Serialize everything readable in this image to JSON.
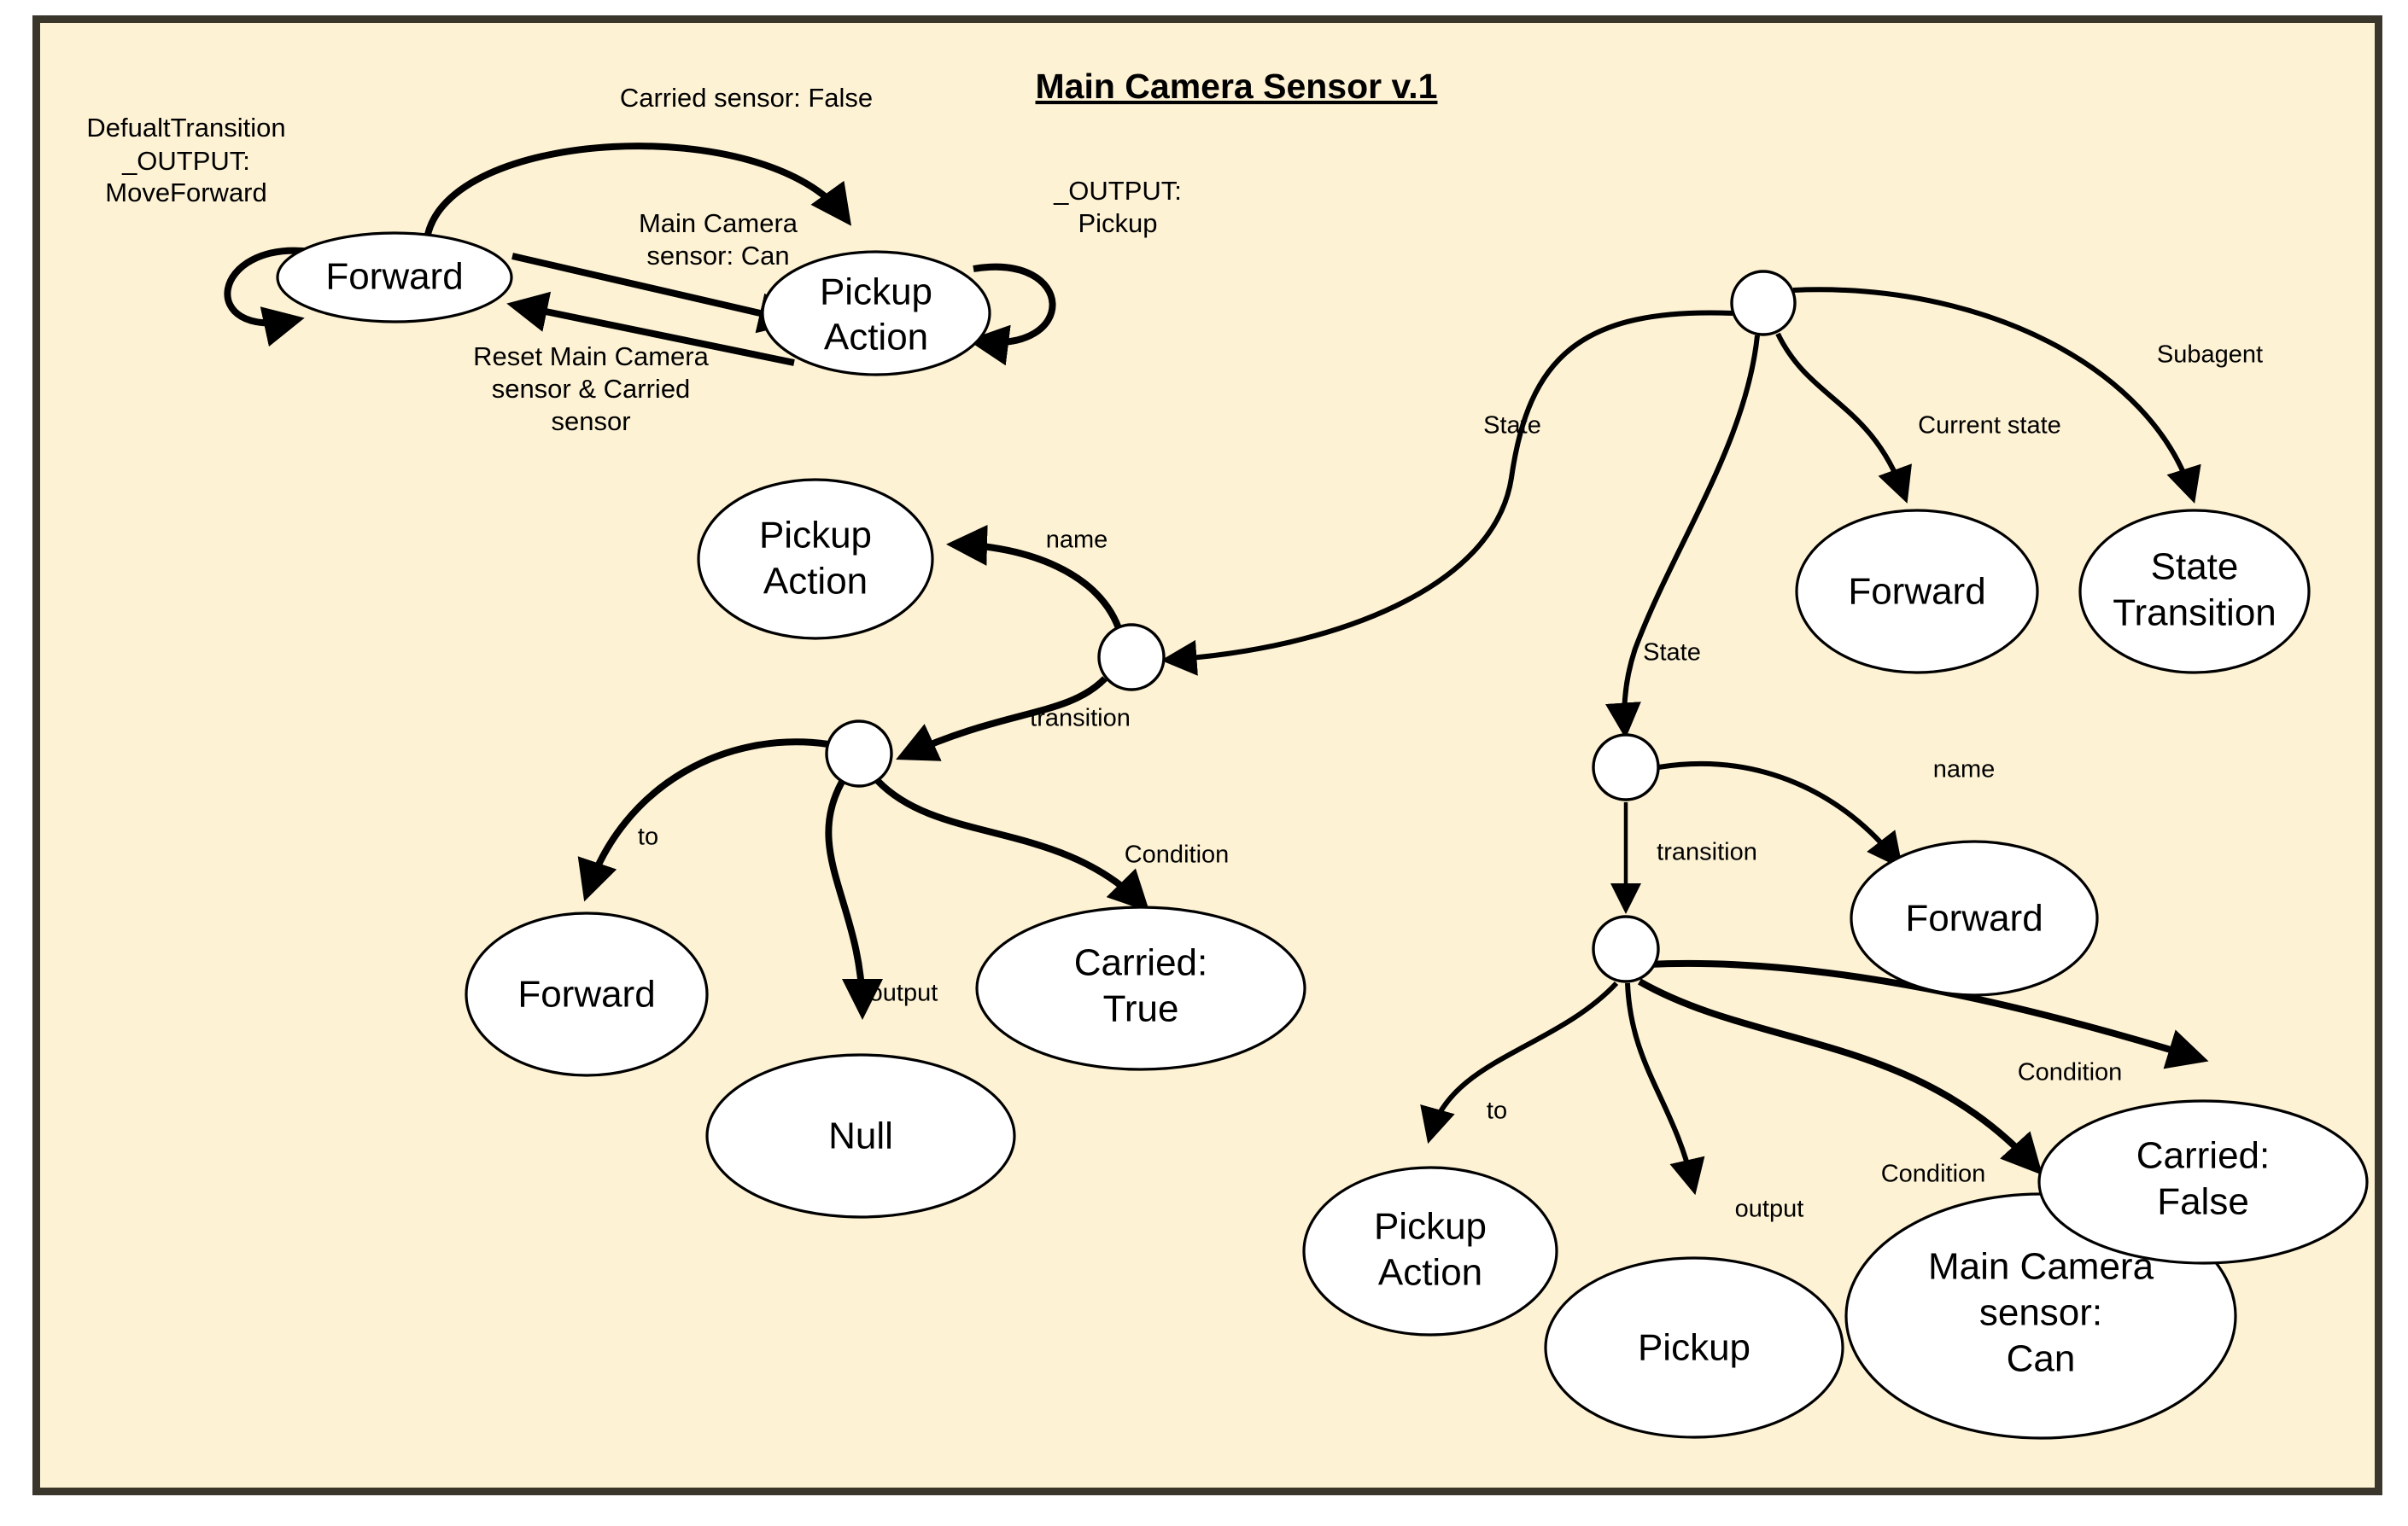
{
  "title": "Main Camera Sensor v.1",
  "colors": {
    "canvas_background": "#fdf2d4",
    "frame_border": "#3b362c",
    "node_fill": "#ffffff",
    "stroke": "#000000",
    "page_background": "#ffffff"
  },
  "state_machine": {
    "states": [
      {
        "id": "sm-forward",
        "label": "Forward"
      },
      {
        "id": "sm-pickup-action",
        "label_line1": "Pickup",
        "label_line2": "Action"
      }
    ],
    "labels": {
      "self_loop_forward_l1": "DefualtTransition",
      "self_loop_forward_l2": "_OUTPUT:",
      "self_loop_forward_l3": "MoveForward",
      "top_arc": "Carried sensor: False",
      "forward_to_pickup_l1": "Main Camera",
      "forward_to_pickup_l2": "sensor: Can",
      "pickup_to_forward_l1": "Reset Main Camera",
      "pickup_to_forward_l2": "sensor & Carried",
      "pickup_to_forward_l3": "sensor",
      "self_loop_pickup_l1": "_OUTPUT:",
      "self_loop_pickup_l2": "Pickup"
    }
  },
  "graph": {
    "junction_nodes": [
      {
        "id": "root",
        "name": "root-junction"
      },
      {
        "id": "left-transition-parent",
        "name": "left-state-junction"
      },
      {
        "id": "left-transition",
        "name": "left-transition-junction"
      },
      {
        "id": "right-state",
        "name": "right-state-junction"
      },
      {
        "id": "right-transition",
        "name": "right-transition-junction"
      }
    ],
    "leaf_nodes": [
      {
        "id": "leaf-pickup-action-name",
        "label_line1": "Pickup",
        "label_line2": "Action"
      },
      {
        "id": "leaf-forward-current-state",
        "label_line1": "Forward",
        "label_line2": ""
      },
      {
        "id": "leaf-state-transition",
        "label_line1": "State",
        "label_line2": "Transition"
      },
      {
        "id": "leaf-forward-to",
        "label_line1": "Forward",
        "label_line2": ""
      },
      {
        "id": "leaf-null-output",
        "label_line1": "Null",
        "label_line2": ""
      },
      {
        "id": "leaf-carried-true",
        "label_line1": "Carried:",
        "label_line2": "True"
      },
      {
        "id": "leaf-forward-name",
        "label_line1": "Forward",
        "label_line2": ""
      },
      {
        "id": "leaf-pickup-action-to",
        "label_line1": "Pickup",
        "label_line2": "Action"
      },
      {
        "id": "leaf-pickup-output",
        "label_line1": "Pickup",
        "label_line2": ""
      },
      {
        "id": "leaf-main-camera-can",
        "label_line1": "Main Camera",
        "label_line2": "sensor:",
        "label_line3": "Can"
      },
      {
        "id": "leaf-carried-false",
        "label_line1": "Carried:",
        "label_line2": "False"
      }
    ],
    "edge_labels": {
      "root_to_left_state": "State",
      "root_to_right_state": "State",
      "root_to_current_state": "Current state",
      "root_to_subagent": "Subagent",
      "left_name": "name",
      "left_transition": "transition",
      "left_to": "to",
      "left_output": "output",
      "left_condition": "Condition",
      "right_name": "name",
      "right_transition": "transition",
      "right_to": "to",
      "right_output": "output",
      "right_condition_1": "Condition",
      "right_condition_2": "Condition"
    }
  }
}
